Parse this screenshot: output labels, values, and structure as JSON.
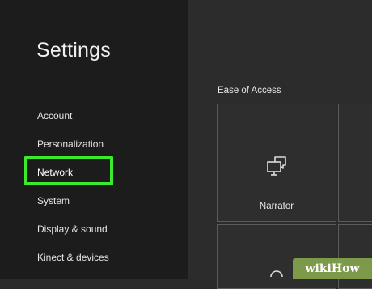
{
  "sidebar": {
    "title": "Settings",
    "items": [
      {
        "label": "Account"
      },
      {
        "label": "Personalization"
      },
      {
        "label": "Network"
      },
      {
        "label": "System"
      },
      {
        "label": "Display & sound"
      },
      {
        "label": "Kinect & devices"
      }
    ],
    "selected_item": "Network"
  },
  "main": {
    "section_label": "Ease of Access",
    "tiles": [
      {
        "label": "Narrator",
        "icon": "narrator-icon"
      },
      {
        "label": "",
        "icon": ""
      },
      {
        "label": "",
        "icon": ""
      },
      {
        "label": "",
        "icon": ""
      }
    ]
  },
  "colors": {
    "highlight": "#3bea2a",
    "sidebar_bg": "#1c1c1c",
    "main_bg": "#2c2c2c",
    "tile_border": "#5b5b5b"
  },
  "watermark": "wikiHow"
}
